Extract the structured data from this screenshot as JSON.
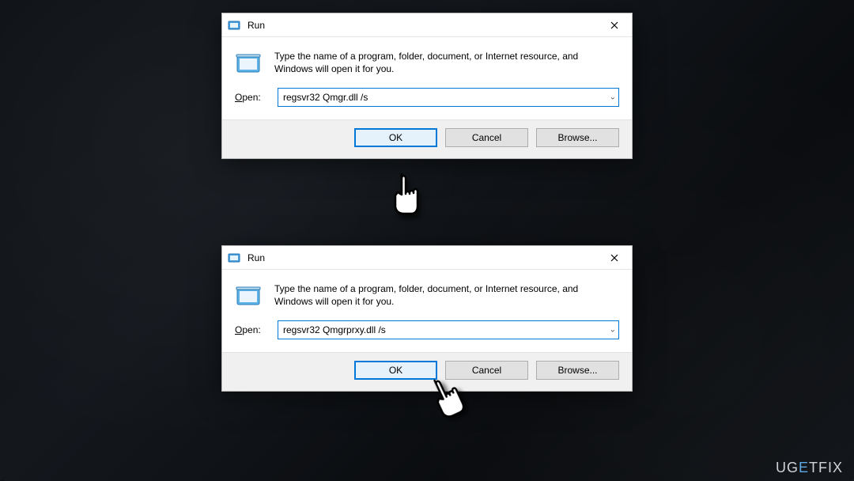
{
  "watermark": {
    "pre": "UG",
    "mid": "E",
    "post": "TFIX"
  },
  "dialogs": [
    {
      "title": "Run",
      "instruction": "Type the name of a program, folder, document, or Internet resource, and Windows will open it for you.",
      "open_label_pre": "O",
      "open_label_post": "pen:",
      "input_value": "regsvr32 Qmgr.dll /s",
      "buttons": {
        "ok": "OK",
        "cancel": "Cancel",
        "browse": "Browse..."
      }
    },
    {
      "title": "Run",
      "instruction": "Type the name of a program, folder, document, or Internet resource, and Windows will open it for you.",
      "open_label_pre": "O",
      "open_label_post": "pen:",
      "input_value": "regsvr32 Qmgrprxy.dll /s",
      "buttons": {
        "ok": "OK",
        "cancel": "Cancel",
        "browse": "Browse..."
      }
    }
  ]
}
